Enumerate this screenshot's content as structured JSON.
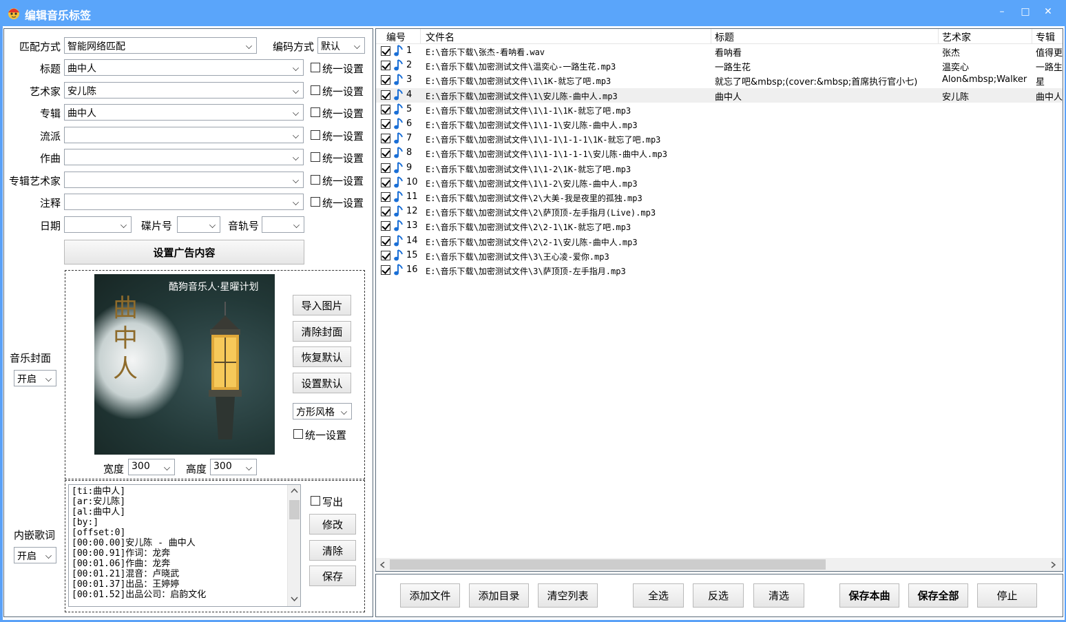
{
  "window": {
    "title": "编辑音乐标签",
    "minimize_glyph": "–",
    "maximize_glyph": "□",
    "close_glyph": "✕"
  },
  "form": {
    "match_label": "匹配方式",
    "match_value": "智能网络匹配",
    "encoding_label": "编码方式",
    "encoding_value": "默认",
    "fields": [
      {
        "label": "标题",
        "value": "曲中人",
        "unify": "统一设置"
      },
      {
        "label": "艺术家",
        "value": "安儿陈",
        "unify": "统一设置"
      },
      {
        "label": "专辑",
        "value": "曲中人",
        "unify": "统一设置"
      },
      {
        "label": "流派",
        "value": "",
        "unify": "统一设置"
      },
      {
        "label": "作曲",
        "value": "",
        "unify": "统一设置"
      },
      {
        "label": "专辑艺术家",
        "value": "",
        "unify": "统一设置"
      },
      {
        "label": "注释",
        "value": "",
        "unify": "统一设置"
      }
    ],
    "date_label": "日期",
    "date_value": "",
    "disc_label": "碟片号",
    "disc_value": "",
    "track_label": "音轨号",
    "track_value": "",
    "ad_button": "设置广告内容"
  },
  "cover": {
    "section_label": "音乐封面",
    "toggle_value": "开启",
    "image_caption": "酷狗音乐人·星曜计划",
    "image_title": "曲中人",
    "buttons": [
      "导入图片",
      "清除封面",
      "恢复默认",
      "设置默认"
    ],
    "style_value": "方形风格",
    "unify_label": "统一设置",
    "width_label": "宽度",
    "width_value": "300",
    "height_label": "高度",
    "height_value": "300"
  },
  "lyrics": {
    "section_label": "内嵌歌词",
    "toggle_value": "开启",
    "lines": [
      "[ti:曲中人]",
      "[ar:安儿陈]",
      "[al:曲中人]",
      "[by:]",
      "[offset:0]",
      "[00:00.00]安儿陈 - 曲中人",
      "[00:00.91]作词：龙奔",
      "[00:01.06]作曲：龙奔",
      "[00:01.21]混音：卢晓武",
      "[00:01.37]出品：王婷婷",
      "[00:01.52]出品公司：启韵文化"
    ],
    "writeout_label": "写出",
    "buttons": [
      "修改",
      "清除",
      "保存"
    ]
  },
  "table": {
    "columns": [
      "编号",
      "文件名",
      "标题",
      "艺术家",
      "专辑"
    ],
    "rows": [
      {
        "num": "1",
        "file": "E:\\音乐下载\\张杰-看呐看.wav",
        "title": "看呐看",
        "artist": "张杰",
        "album": "值得更"
      },
      {
        "num": "2",
        "file": "E:\\音乐下载\\加密测试文件\\温奕心-一路生花.mp3",
        "title": "一路生花",
        "artist": "温奕心",
        "album": "一路生"
      },
      {
        "num": "3",
        "file": "E:\\音乐下载\\加密测试文件\\1\\1K-就忘了吧.mp3",
        "title": "就忘了吧&mbsp;(cover:&mbsp;首席执行官小七)",
        "artist": "Alon&mbsp;Walker",
        "album": "星"
      },
      {
        "num": "4",
        "file": "E:\\音乐下载\\加密测试文件\\1\\安儿陈-曲中人.mp3",
        "title": "曲中人",
        "artist": "安儿陈",
        "album": "曲中人"
      },
      {
        "num": "5",
        "file": "E:\\音乐下载\\加密测试文件\\1\\1-1\\1K-就忘了吧.mp3",
        "title": "",
        "artist": "",
        "album": ""
      },
      {
        "num": "6",
        "file": "E:\\音乐下载\\加密测试文件\\1\\1-1\\安儿陈-曲中人.mp3",
        "title": "",
        "artist": "",
        "album": ""
      },
      {
        "num": "7",
        "file": "E:\\音乐下载\\加密测试文件\\1\\1-1\\1-1-1\\1K-就忘了吧.mp3",
        "title": "",
        "artist": "",
        "album": ""
      },
      {
        "num": "8",
        "file": "E:\\音乐下载\\加密测试文件\\1\\1-1\\1-1-1\\安儿陈-曲中人.mp3",
        "title": "",
        "artist": "",
        "album": ""
      },
      {
        "num": "9",
        "file": "E:\\音乐下载\\加密测试文件\\1\\1-2\\1K-就忘了吧.mp3",
        "title": "",
        "artist": "",
        "album": ""
      },
      {
        "num": "10",
        "file": "E:\\音乐下载\\加密测试文件\\1\\1-2\\安儿陈-曲中人.mp3",
        "title": "",
        "artist": "",
        "album": ""
      },
      {
        "num": "11",
        "file": "E:\\音乐下载\\加密测试文件\\2\\大美-我是夜里的孤独.mp3",
        "title": "",
        "artist": "",
        "album": ""
      },
      {
        "num": "12",
        "file": "E:\\音乐下载\\加密测试文件\\2\\萨顶顶-左手指月(Live).mp3",
        "title": "",
        "artist": "",
        "album": ""
      },
      {
        "num": "13",
        "file": "E:\\音乐下载\\加密测试文件\\2\\2-1\\1K-就忘了吧.mp3",
        "title": "",
        "artist": "",
        "album": ""
      },
      {
        "num": "14",
        "file": "E:\\音乐下载\\加密测试文件\\2\\2-1\\安儿陈-曲中人.mp3",
        "title": "",
        "artist": "",
        "album": ""
      },
      {
        "num": "15",
        "file": "E:\\音乐下载\\加密测试文件\\3\\王心凌-爱你.mp3",
        "title": "",
        "artist": "",
        "album": ""
      },
      {
        "num": "16",
        "file": "E:\\音乐下载\\加密测试文件\\3\\萨顶顶-左手指月.mp3",
        "title": "",
        "artist": "",
        "album": ""
      }
    ],
    "selected_row": 4
  },
  "bottom_buttons": {
    "add_file": "添加文件",
    "add_dir": "添加目录",
    "clear_list": "清空列表",
    "select_all": "全选",
    "invert": "反选",
    "clear_sel": "清选",
    "save_this": "保存本曲",
    "save_all": "保存全部",
    "stop": "停止"
  },
  "colors": {
    "titlebar": "#5aa5fa",
    "note_icon": "#1a6fd6",
    "selected_row": "#efefef"
  }
}
